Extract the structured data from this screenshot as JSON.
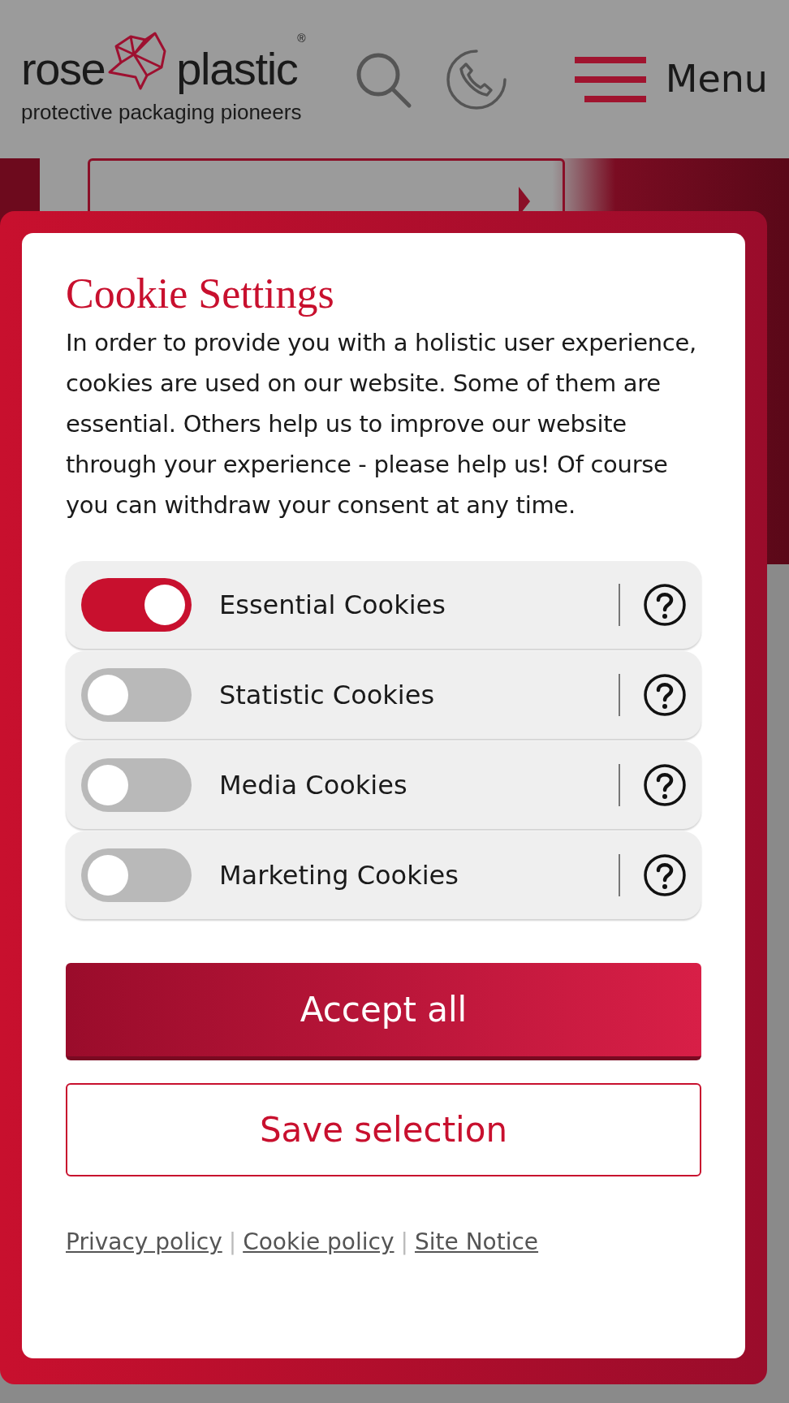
{
  "header": {
    "logo": {
      "word_1": "rose",
      "word_2": "plastic",
      "registered": "®",
      "tagline": "protective packaging pioneers"
    },
    "menu_label": "Menu"
  },
  "dialog": {
    "title": "Cookie Settings",
    "text": "In order to provide you with a holistic user experience, cookies are used on our website. Some of them are essential. Others help us to improve our website through your experience - please help us! Of course you can withdraw your consent at any time.",
    "options": [
      {
        "label": "Essential Cookies",
        "on": true
      },
      {
        "label": "Statistic Cookies",
        "on": false
      },
      {
        "label": "Media Cookies",
        "on": false
      },
      {
        "label": "Marketing Cookies",
        "on": false
      }
    ],
    "accept_button": "Accept all",
    "save_button": "Save selection",
    "links": [
      {
        "label": "Privacy policy"
      },
      {
        "label": "Cookie policy"
      },
      {
        "label": "Site Notice"
      }
    ],
    "separators": [
      "|",
      "|"
    ]
  }
}
